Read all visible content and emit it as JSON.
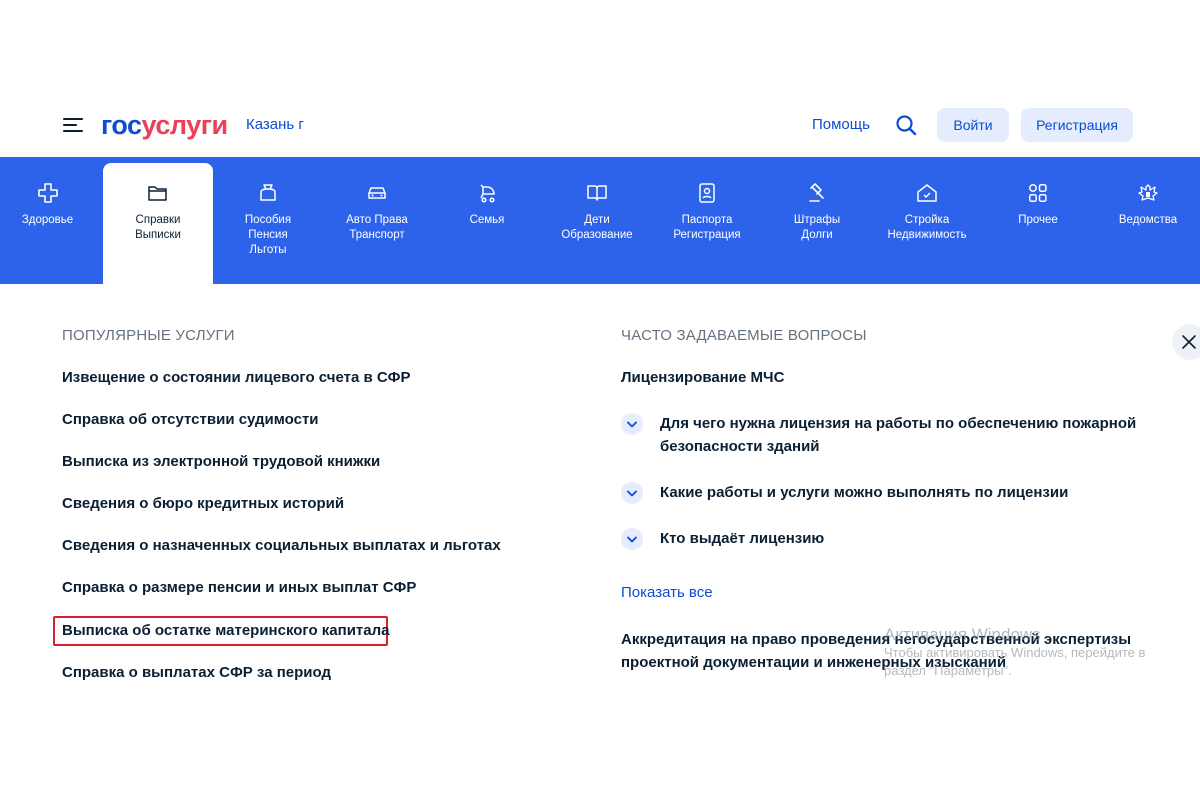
{
  "header": {
    "logo_part1": "гос",
    "logo_part2": "услуги",
    "city": "Казань г",
    "help": "Помощь",
    "login": "Войти",
    "register": "Регистрация"
  },
  "colors": {
    "brand_blue": "#0d4cd3",
    "nav_blue": "#2d63eb",
    "logo_red": "#ee3f58",
    "highlight_red": "#d8202b"
  },
  "nav": {
    "items": [
      {
        "label": "Здоровье",
        "icon": "medical-cross-icon"
      },
      {
        "label": "Справки\nВыписки",
        "icon": "folder-icon",
        "active": true
      },
      {
        "label": "Пособия\nПенсия\nЛьготы",
        "icon": "wallet-icon"
      },
      {
        "label": "Авто Права\nТранспорт",
        "icon": "car-icon"
      },
      {
        "label": "Семья",
        "icon": "stroller-icon"
      },
      {
        "label": "Дети\nОбразование",
        "icon": "book-icon"
      },
      {
        "label": "Паспорта\nРегистрация",
        "icon": "passport-icon"
      },
      {
        "label": "Штрафы\nДолги",
        "icon": "gavel-icon"
      },
      {
        "label": "Стройка\nНедвижимость",
        "icon": "house-icon"
      },
      {
        "label": "Прочее",
        "icon": "grid-icon"
      },
      {
        "label": "Ведомства",
        "icon": "emblem-icon"
      }
    ]
  },
  "popular": {
    "title": "ПОПУЛЯРНЫЕ УСЛУГИ",
    "items": [
      "Извещение о состоянии лицевого счета в СФР",
      "Справка об отсутствии судимости",
      "Выписка из электронной трудовой книжки",
      "Сведения о бюро кредитных историй",
      "Сведения о назначенных социальных выплатах и льготах",
      "Справка о размере пенсии и иных выплат СФР",
      "Выписка об остатке материнского капитала",
      "Справка о выплатах СФР за период"
    ]
  },
  "faq": {
    "title": "ЧАСТО ЗАДАВАЕМЫЕ ВОПРОСЫ",
    "group1": "Лицензирование МЧС",
    "questions": [
      "Для чего нужна лицензия на работы по обеспечению пожарной безопасности зданий",
      "Какие работы и услуги можно выполнять по лицензии",
      "Кто выдаёт лицензию"
    ],
    "show_all": "Показать все",
    "group2": "Аккредитация на право проведения негосударственной экспертизы проектной документации и инженерных изысканий"
  },
  "watermark": {
    "line1": "Активация Windows",
    "line2": "Чтобы активировать Windows, перейдите в",
    "line3": "раздел \"Параметры\"."
  }
}
